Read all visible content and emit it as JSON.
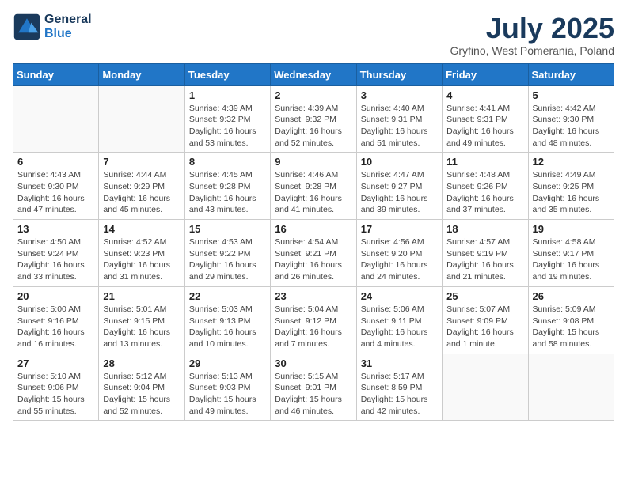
{
  "logo": {
    "line1": "General",
    "line2": "Blue"
  },
  "title": "July 2025",
  "subtitle": "Gryfino, West Pomerania, Poland",
  "days_header": [
    "Sunday",
    "Monday",
    "Tuesday",
    "Wednesday",
    "Thursday",
    "Friday",
    "Saturday"
  ],
  "weeks": [
    [
      {
        "day": "",
        "info": ""
      },
      {
        "day": "",
        "info": ""
      },
      {
        "day": "1",
        "info": "Sunrise: 4:39 AM\nSunset: 9:32 PM\nDaylight: 16 hours\nand 53 minutes."
      },
      {
        "day": "2",
        "info": "Sunrise: 4:39 AM\nSunset: 9:32 PM\nDaylight: 16 hours\nand 52 minutes."
      },
      {
        "day": "3",
        "info": "Sunrise: 4:40 AM\nSunset: 9:31 PM\nDaylight: 16 hours\nand 51 minutes."
      },
      {
        "day": "4",
        "info": "Sunrise: 4:41 AM\nSunset: 9:31 PM\nDaylight: 16 hours\nand 49 minutes."
      },
      {
        "day": "5",
        "info": "Sunrise: 4:42 AM\nSunset: 9:30 PM\nDaylight: 16 hours\nand 48 minutes."
      }
    ],
    [
      {
        "day": "6",
        "info": "Sunrise: 4:43 AM\nSunset: 9:30 PM\nDaylight: 16 hours\nand 47 minutes."
      },
      {
        "day": "7",
        "info": "Sunrise: 4:44 AM\nSunset: 9:29 PM\nDaylight: 16 hours\nand 45 minutes."
      },
      {
        "day": "8",
        "info": "Sunrise: 4:45 AM\nSunset: 9:28 PM\nDaylight: 16 hours\nand 43 minutes."
      },
      {
        "day": "9",
        "info": "Sunrise: 4:46 AM\nSunset: 9:28 PM\nDaylight: 16 hours\nand 41 minutes."
      },
      {
        "day": "10",
        "info": "Sunrise: 4:47 AM\nSunset: 9:27 PM\nDaylight: 16 hours\nand 39 minutes."
      },
      {
        "day": "11",
        "info": "Sunrise: 4:48 AM\nSunset: 9:26 PM\nDaylight: 16 hours\nand 37 minutes."
      },
      {
        "day": "12",
        "info": "Sunrise: 4:49 AM\nSunset: 9:25 PM\nDaylight: 16 hours\nand 35 minutes."
      }
    ],
    [
      {
        "day": "13",
        "info": "Sunrise: 4:50 AM\nSunset: 9:24 PM\nDaylight: 16 hours\nand 33 minutes."
      },
      {
        "day": "14",
        "info": "Sunrise: 4:52 AM\nSunset: 9:23 PM\nDaylight: 16 hours\nand 31 minutes."
      },
      {
        "day": "15",
        "info": "Sunrise: 4:53 AM\nSunset: 9:22 PM\nDaylight: 16 hours\nand 29 minutes."
      },
      {
        "day": "16",
        "info": "Sunrise: 4:54 AM\nSunset: 9:21 PM\nDaylight: 16 hours\nand 26 minutes."
      },
      {
        "day": "17",
        "info": "Sunrise: 4:56 AM\nSunset: 9:20 PM\nDaylight: 16 hours\nand 24 minutes."
      },
      {
        "day": "18",
        "info": "Sunrise: 4:57 AM\nSunset: 9:19 PM\nDaylight: 16 hours\nand 21 minutes."
      },
      {
        "day": "19",
        "info": "Sunrise: 4:58 AM\nSunset: 9:17 PM\nDaylight: 16 hours\nand 19 minutes."
      }
    ],
    [
      {
        "day": "20",
        "info": "Sunrise: 5:00 AM\nSunset: 9:16 PM\nDaylight: 16 hours\nand 16 minutes."
      },
      {
        "day": "21",
        "info": "Sunrise: 5:01 AM\nSunset: 9:15 PM\nDaylight: 16 hours\nand 13 minutes."
      },
      {
        "day": "22",
        "info": "Sunrise: 5:03 AM\nSunset: 9:13 PM\nDaylight: 16 hours\nand 10 minutes."
      },
      {
        "day": "23",
        "info": "Sunrise: 5:04 AM\nSunset: 9:12 PM\nDaylight: 16 hours\nand 7 minutes."
      },
      {
        "day": "24",
        "info": "Sunrise: 5:06 AM\nSunset: 9:11 PM\nDaylight: 16 hours\nand 4 minutes."
      },
      {
        "day": "25",
        "info": "Sunrise: 5:07 AM\nSunset: 9:09 PM\nDaylight: 16 hours\nand 1 minute."
      },
      {
        "day": "26",
        "info": "Sunrise: 5:09 AM\nSunset: 9:08 PM\nDaylight: 15 hours\nand 58 minutes."
      }
    ],
    [
      {
        "day": "27",
        "info": "Sunrise: 5:10 AM\nSunset: 9:06 PM\nDaylight: 15 hours\nand 55 minutes."
      },
      {
        "day": "28",
        "info": "Sunrise: 5:12 AM\nSunset: 9:04 PM\nDaylight: 15 hours\nand 52 minutes."
      },
      {
        "day": "29",
        "info": "Sunrise: 5:13 AM\nSunset: 9:03 PM\nDaylight: 15 hours\nand 49 minutes."
      },
      {
        "day": "30",
        "info": "Sunrise: 5:15 AM\nSunset: 9:01 PM\nDaylight: 15 hours\nand 46 minutes."
      },
      {
        "day": "31",
        "info": "Sunrise: 5:17 AM\nSunset: 8:59 PM\nDaylight: 15 hours\nand 42 minutes."
      },
      {
        "day": "",
        "info": ""
      },
      {
        "day": "",
        "info": ""
      }
    ]
  ]
}
